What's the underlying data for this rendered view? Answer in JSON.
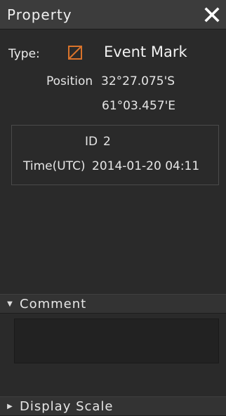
{
  "window": {
    "title": "Property",
    "close_glyph": "✕"
  },
  "type_row": {
    "label": "Type:",
    "icon": "event-mark-icon",
    "icon_color": "#d9732b",
    "value": "Event Mark"
  },
  "position": {
    "label": "Position",
    "lat": "32°27.075'S",
    "lon": "61°03.457'E"
  },
  "info": {
    "id_label": "ID",
    "id_value": "2",
    "time_label": "Time(UTC)",
    "time_value": "2014-01-20 04:11"
  },
  "sections": {
    "comment": {
      "label": "Comment",
      "arrow": "▼"
    },
    "display_scale": {
      "label": "Display Scale",
      "arrow": "▶"
    }
  },
  "comment": {
    "value": ""
  }
}
